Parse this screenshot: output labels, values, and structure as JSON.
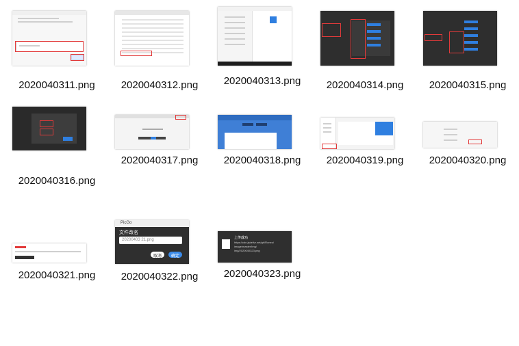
{
  "files": [
    {
      "name": "2020040311.png"
    },
    {
      "name": "2020040312.png"
    },
    {
      "name": "2020040313.png"
    },
    {
      "name": "2020040314.png"
    },
    {
      "name": "2020040315.png"
    },
    {
      "name": "2020040316.png"
    },
    {
      "name": "2020040317.png"
    },
    {
      "name": "2020040318.png"
    },
    {
      "name": "2020040319.png"
    },
    {
      "name": "2020040320.png"
    },
    {
      "name": "2020040321.png"
    },
    {
      "name": "2020040322.png"
    },
    {
      "name": "2020040323.png"
    }
  ],
  "thumb322": {
    "app": "PicGo",
    "title": "文件改名",
    "value": "20200403 21.png",
    "cancel": "取消",
    "ok": "确定"
  },
  "thumb323": {
    "title": "上传成功",
    "line1": "https://cdn.jsdelivr.net/gh/Roneo/",
    "line2": "image/master/img/",
    "line3": "img/2020040323.png"
  }
}
